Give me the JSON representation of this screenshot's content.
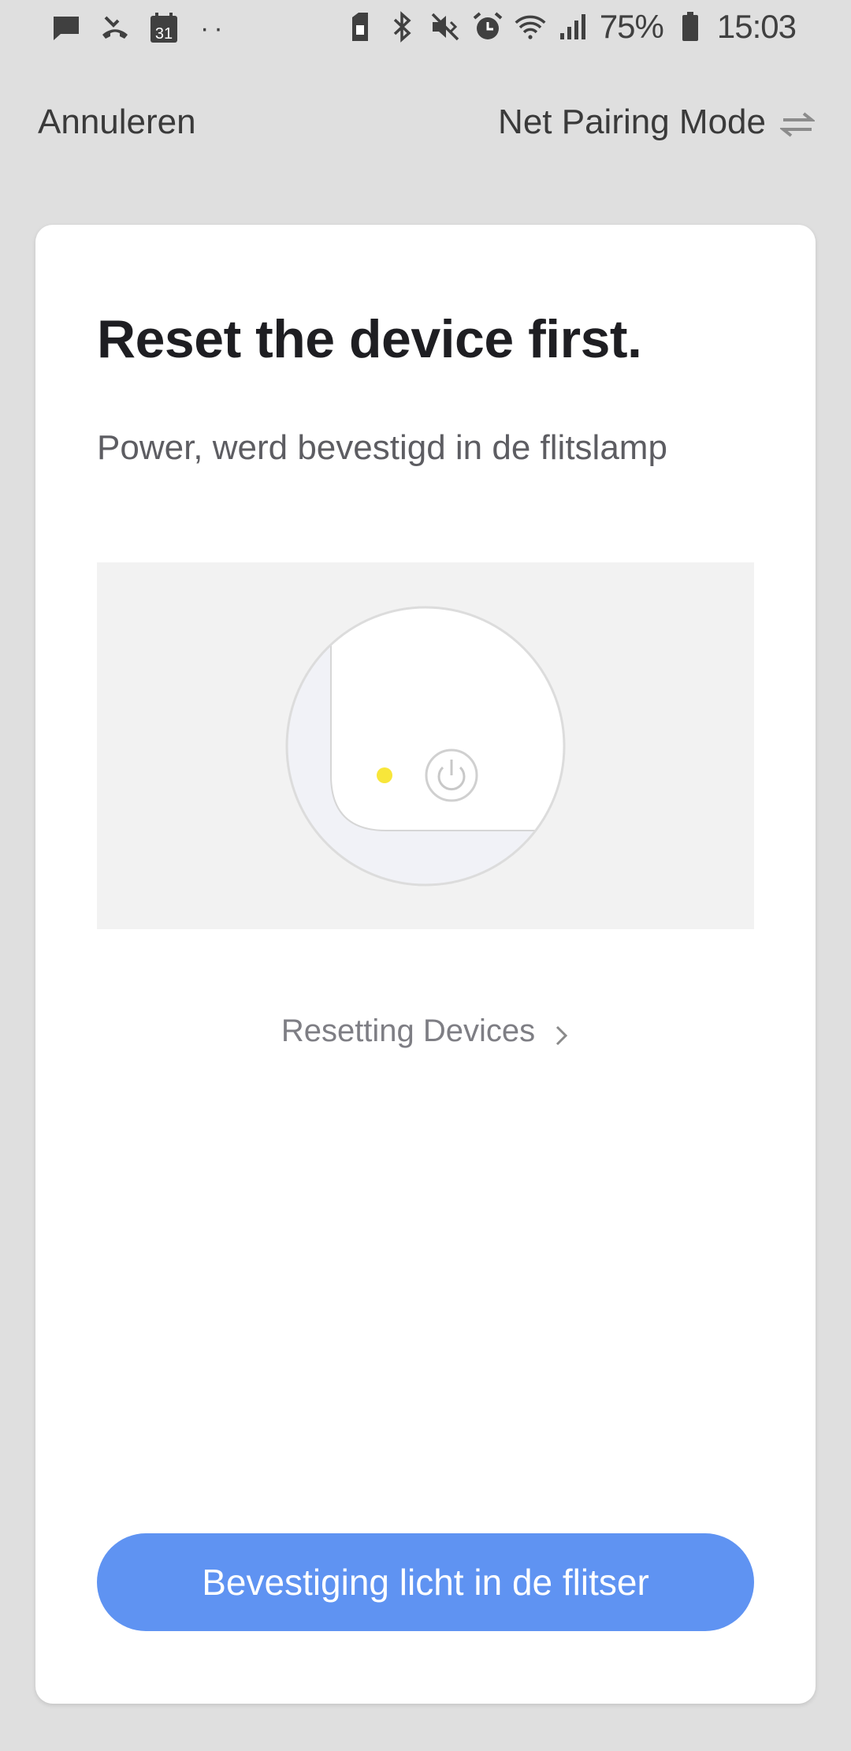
{
  "status_bar": {
    "left_icons": [
      "message-icon",
      "missed-call-icon",
      "calendar-icon"
    ],
    "calendar_day": "31",
    "more_dots": "··",
    "right_icons": [
      "sim-icon",
      "bluetooth-icon",
      "vibrate-icon",
      "alarm-icon",
      "wifi-icon",
      "signal-icon",
      "battery-icon"
    ],
    "battery_percent": "75%",
    "time": "15:03"
  },
  "nav": {
    "cancel_label": "Annuleren",
    "mode_label": "Net Pairing Mode",
    "mode_icon": "swap-arrows-icon"
  },
  "card": {
    "title": "Reset the device first.",
    "subtitle": "Power, werd bevestigd in de flitslamp",
    "illustration_icons": [
      "indicator-light-icon",
      "power-button-icon"
    ],
    "indicator_color": "#f8e63a",
    "reset_link_label": "Resetting Devices",
    "confirm_button_label": "Bevestiging licht in de flitser"
  },
  "colors": {
    "accent": "#5f93f2",
    "background": "#dfdfdf",
    "card": "#ffffff"
  }
}
